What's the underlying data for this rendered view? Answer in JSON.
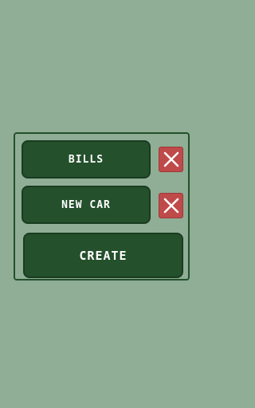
{
  "items": [
    {
      "label": "BILLS",
      "delete_icon": "close-x-icon"
    },
    {
      "label": "NEW CAR",
      "delete_icon": "close-x-icon"
    }
  ],
  "create_label": "CREATE",
  "colors": {
    "background": "#8fae95",
    "button": "#24502c",
    "panel_border": "#24502c",
    "delete": "#bf4a4a",
    "text": "#ffffff"
  }
}
